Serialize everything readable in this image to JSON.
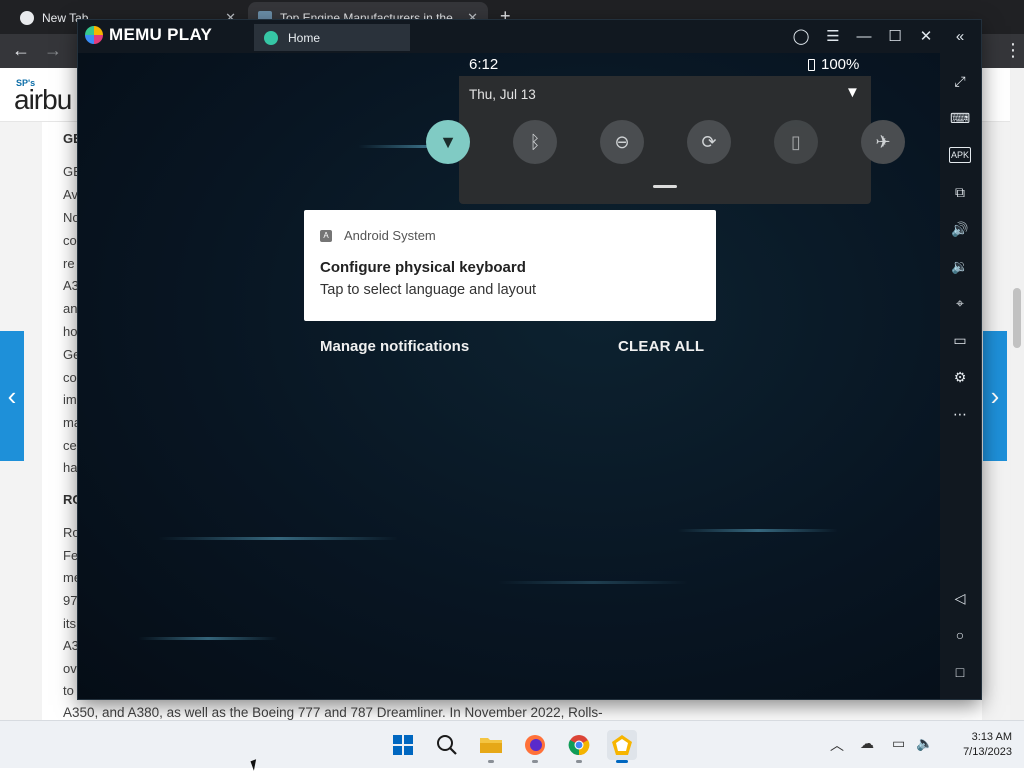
{
  "chrome": {
    "tabs": [
      {
        "title": "New Tab",
        "active": false
      },
      {
        "title": "Top Engine Manufacturers in the",
        "active": true
      }
    ],
    "new_tab_symbol": "+"
  },
  "webpage": {
    "brand_small": "SP's",
    "brand": "airbu",
    "fragments": [
      {
        "text": "GE",
        "bold": true
      },
      {
        "text": "GE",
        "bold": false
      },
      {
        "text": "Av",
        "bold": false
      },
      {
        "text": "No",
        "bold": false
      },
      {
        "text": "co",
        "bold": false
      },
      {
        "text": "re",
        "bold": false
      },
      {
        "text": "A3",
        "bold": false
      },
      {
        "text": "an",
        "bold": false
      },
      {
        "text": "ho",
        "bold": false
      },
      {
        "text": "Ge",
        "bold": false
      },
      {
        "text": "co",
        "bold": false
      },
      {
        "text": "im",
        "bold": false
      },
      {
        "text": "ma",
        "bold": false
      },
      {
        "text": "ce",
        "bold": false
      },
      {
        "text": "ha",
        "bold": false
      },
      {
        "text": "RO",
        "bold": true
      },
      {
        "text": "Ro",
        "bold": false
      },
      {
        "text": "Fe",
        "bold": false
      },
      {
        "text": "me",
        "bold": false
      },
      {
        "text": "97",
        "bold": false
      },
      {
        "text": "its",
        "bold": false
      },
      {
        "text": "A3",
        "bold": false
      },
      {
        "text": "ov",
        "bold": false
      },
      {
        "text": "to",
        "bold": false
      }
    ],
    "bottom_line": "A350, and A380, as well as the Boeing 777 and 787 Dreamliner. In November 2022, Rolls-"
  },
  "memu": {
    "logo_text": "MEMU PLAY",
    "tab_label": "Home",
    "sidebar_icons": [
      "fullscreen-icon",
      "keyboard-icon",
      "apk-icon",
      "multi-instance-icon",
      "volume-up-icon",
      "volume-down-icon",
      "location-icon",
      "folder-icon",
      "settings-icon",
      "more-icon",
      "back-icon",
      "home-icon",
      "recents-icon"
    ]
  },
  "android": {
    "time": "6:12",
    "battery": "100%",
    "date": "Thu, Jul 13",
    "quick_tiles": [
      {
        "name": "wifi",
        "on": true
      },
      {
        "name": "bluetooth",
        "on": false
      },
      {
        "name": "do-not-disturb",
        "on": false
      },
      {
        "name": "auto-rotate",
        "on": false
      },
      {
        "name": "battery-saver",
        "on": false
      },
      {
        "name": "airplane-mode",
        "on": false
      }
    ],
    "notification": {
      "app": "Android System",
      "title": "Configure physical keyboard",
      "body": "Tap to select language and layout"
    },
    "manage_label": "Manage notifications",
    "clear_label": "CLEAR ALL"
  },
  "taskbar": {
    "time": "3:13 AM",
    "date": "7/13/2023",
    "apps": [
      "start",
      "search",
      "file-explorer",
      "firefox",
      "chrome",
      "memu"
    ]
  },
  "colors": {
    "memu_bg": "#0b1724",
    "qs_active": "#80cbc4",
    "side_arrow": "#1e90d9",
    "windows_accent": "#0067c0"
  }
}
